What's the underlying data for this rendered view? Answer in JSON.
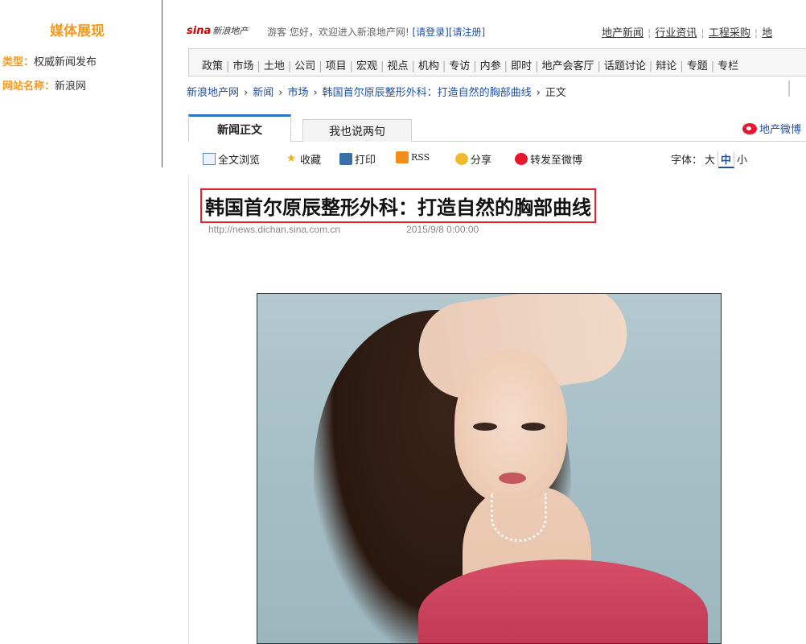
{
  "sidebar": {
    "title": "媒体展现",
    "type_label": "类型：",
    "type_value": "权威新闻发布",
    "site_label": "网站名称：",
    "site_value": "新浪网"
  },
  "header": {
    "logo_main": "sina",
    "logo_sub": "新浪地产",
    "greeting": "游客 您好，欢迎进入新浪地产网!",
    "login": "[请登录]",
    "register": "[请注册]",
    "top_links": [
      "地产新闻",
      "行业资讯",
      "工程采购",
      "地"
    ]
  },
  "nav": {
    "items": [
      "政策",
      "市场",
      "土地",
      "公司",
      "项目",
      "宏观",
      "视点",
      "机构",
      "专访",
      "内参",
      "即时",
      "地产会客厅",
      "话题讨论",
      "辩论",
      "专题",
      "专栏"
    ]
  },
  "breadcrumb": {
    "items": [
      "新浪地产网",
      "新闻",
      "市场",
      "韩国首尔原辰整形外科：打造自然的胸部曲线"
    ],
    "current": "正文"
  },
  "tabs": {
    "news_body": "新闻正文",
    "comment": "我也说两句",
    "weibo": "地产微博"
  },
  "tools": {
    "fulltext": "全文浏览",
    "favorite": "收藏",
    "print": "打印",
    "rss": "RSS",
    "share": "分享",
    "forward": "转发至微博",
    "font_label": "字体：",
    "font_sizes": [
      "大",
      "中",
      "小"
    ],
    "font_selected": "中"
  },
  "article": {
    "headline": "韩国首尔原辰整形外科：打造自然的胸部曲线",
    "source_url": "http://news.dichan.sina.com.cn",
    "date": "2015/9/8 0:00:00"
  },
  "icons": [
    "doc-icon",
    "star-icon",
    "printer-icon",
    "rss-icon",
    "share-icon",
    "weibo-icon"
  ],
  "colors": {
    "accent_orange": "#f39a1e",
    "link_blue": "#1e50a2",
    "headline_border": "#e0262c",
    "tab_top": "#2b73c4"
  }
}
